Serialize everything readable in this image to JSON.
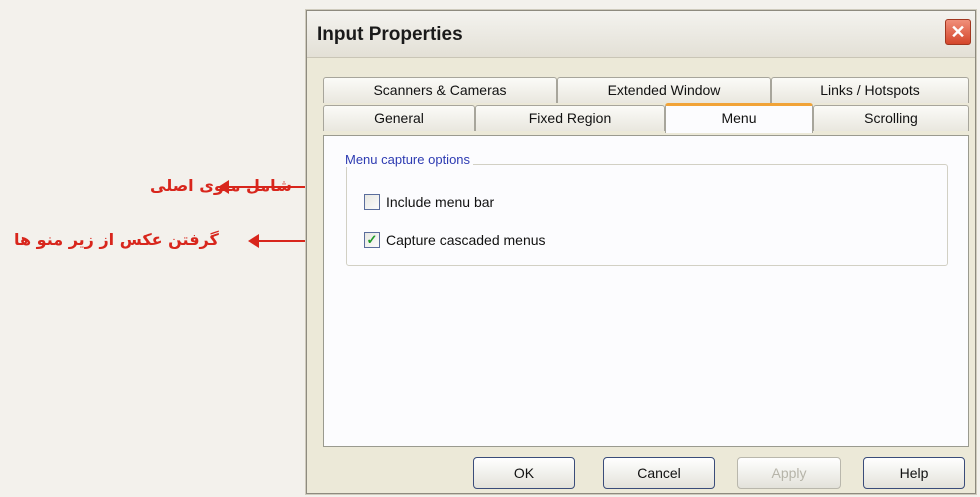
{
  "annotations": [
    {
      "text": "شامل منوی اصلی"
    },
    {
      "text": "گرفتن عکس از زیر منو ها"
    }
  ],
  "dialog": {
    "title": "Input Properties",
    "close_symbol": "✕",
    "tabs_row1": [
      "Scanners & Cameras",
      "Extended Window",
      "Links / Hotspots"
    ],
    "tabs_row2": [
      "General",
      "Fixed Region",
      "Menu",
      "Scrolling"
    ],
    "active_tab": "Menu",
    "group_title": "Menu capture options",
    "options": [
      {
        "label": "Include menu bar",
        "checked": false
      },
      {
        "label": "Capture cascaded menus",
        "checked": true
      }
    ],
    "buttons": {
      "ok": "OK",
      "cancel": "Cancel",
      "apply": "Apply",
      "help": "Help"
    }
  },
  "colors": {
    "accent_tab": "#f1a337",
    "annotation": "#d8261c",
    "legend": "#2d3bb2"
  }
}
